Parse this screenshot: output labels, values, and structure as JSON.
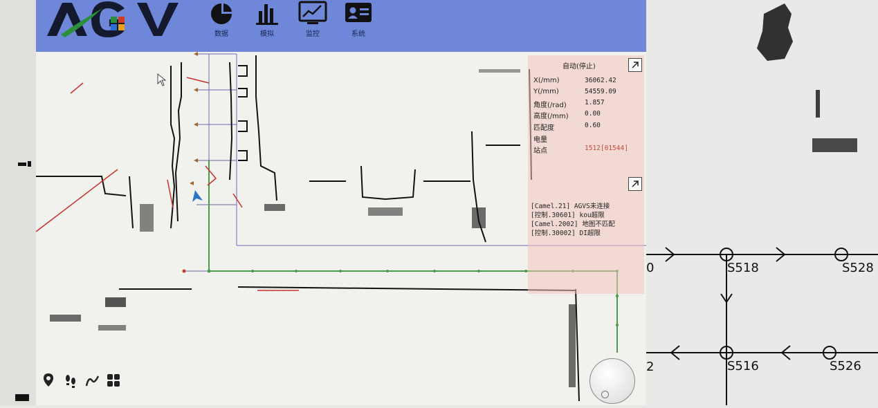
{
  "header": {
    "logo_text": "AGV",
    "logo_colors": [
      "#2a8f3a",
      "#d23b2a",
      "#2a6fd2",
      "#e8a21c"
    ],
    "nav": [
      {
        "label": "数据",
        "icon": "pie-chart-icon"
      },
      {
        "label": "模拟",
        "icon": "bar-chart-icon"
      },
      {
        "label": "监控",
        "icon": "line-chart-monitor-icon"
      },
      {
        "label": "系统",
        "icon": "id-card-icon"
      }
    ]
  },
  "status": {
    "title": "自动(停止)",
    "rows": [
      {
        "key": "X(/mm)",
        "value": "36062.42"
      },
      {
        "key": "Y(/mm)",
        "value": "54559.09"
      },
      {
        "key": "角度(/rad)",
        "value": "1.857"
      },
      {
        "key": "高度(/mm)",
        "value": "0.00"
      },
      {
        "key": "匹配度",
        "value": "0.60"
      },
      {
        "key": "电量",
        "value": ""
      },
      {
        "key": "站点",
        "value": "1512[01544]",
        "color": "#c24a3a"
      }
    ]
  },
  "log": {
    "lines": [
      "[Camel.21] AGVS未连接",
      "[控制.30601] kou超限",
      "[Camel.2002] 地图不匹配",
      "[控制.30002] DI超限"
    ]
  },
  "toolbar": {
    "tools": [
      "location-pin-icon",
      "footprints-icon",
      "draw-path-icon",
      "apps-grid-icon"
    ]
  },
  "topology": {
    "stations": [
      "S518",
      "S528",
      "S516",
      "S526"
    ],
    "edge_labels": [
      "0",
      "2"
    ]
  }
}
